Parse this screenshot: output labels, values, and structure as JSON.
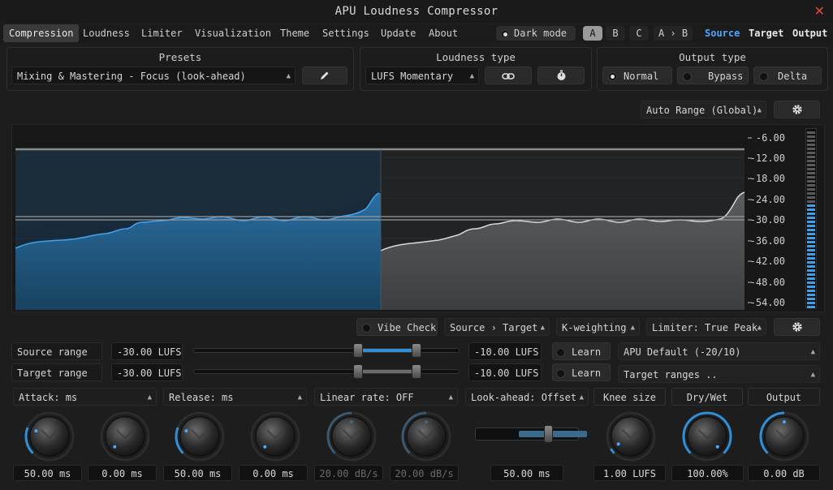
{
  "window": {
    "title": "APU Loudness Compressor",
    "close_glyph": "✕"
  },
  "menu": {
    "tabs": [
      "Compression",
      "Loudness",
      "Limiter",
      "Visualization",
      "Theme",
      "Settings",
      "Update",
      "About"
    ],
    "active_tab": "Compression",
    "dark_mode_label": "Dark mode",
    "ab": [
      "A",
      "B",
      "C",
      "A › B"
    ],
    "ab_active": "A",
    "views": [
      "Source",
      "Target",
      "Output"
    ],
    "view_active": "Source"
  },
  "presets": {
    "title": "Presets",
    "selected": "Mixing & Mastering - Focus (look-ahead)",
    "edit_icon": "pencil-icon"
  },
  "loudness_type": {
    "title": "Loudness type",
    "selected": "LUFS Momentary",
    "link_icon": "link-icon",
    "timer_icon": "stopwatch-icon"
  },
  "output_type": {
    "title": "Output type",
    "options": [
      "Normal",
      "Bypass",
      "Delta"
    ],
    "selected": "Normal"
  },
  "range_mode": {
    "selected": "Auto Range (Global)",
    "settings_icon": "gear-icon"
  },
  "graph": {
    "scale": [
      "-6.00",
      "-12.00",
      "-18.00",
      "-24.00",
      "-30.00",
      "-36.00",
      "-42.00",
      "-48.00",
      "-54.00"
    ],
    "meter_level": 0.58,
    "colors": {
      "source": "#2f8fd8",
      "target": "#d8d8d8",
      "source_fill": "#1f5277",
      "target_fill": "#4a4c4e"
    }
  },
  "controls_row": {
    "vibe_check": "Vibe Check",
    "signal": "Source › Target",
    "weighting": "K-weighting",
    "limiter": "Limiter: True Peak",
    "settings_icon": "gear-icon"
  },
  "ranges": {
    "source": {
      "label": "Source range",
      "min": "-30.00 LUFS",
      "max": "-10.00 LUFS",
      "learn": "Learn",
      "low": 0.62,
      "high": 0.84
    },
    "target": {
      "label": "Target range",
      "min": "-30.00 LUFS",
      "max": "-10.00 LUFS",
      "learn": "Learn",
      "low": 0.62,
      "high": 0.84
    },
    "preset": "APU Default (-20/10)",
    "target_ranges": "Target ranges .."
  },
  "params": {
    "attack": "Attack: ms",
    "release": "Release: ms",
    "linear_rate": "Linear rate: OFF",
    "lookahead": "Look-ahead: Offset",
    "knee": "Knee size",
    "drywet": "Dry/Wet",
    "output": "Output"
  },
  "knobs": [
    {
      "value": "50.00 ms",
      "dim": false,
      "level": 0.25
    },
    {
      "value": "0.00 ms",
      "dim": false,
      "level": 0.0
    },
    {
      "value": "50.00 ms",
      "dim": false,
      "level": 0.25
    },
    {
      "value": "0.00 ms",
      "dim": false,
      "level": 0.0
    },
    {
      "value": "20.00 dB/s",
      "dim": true,
      "level": 0.5
    },
    {
      "value": "20.00 dB/s",
      "dim": true,
      "level": 0.5
    },
    {
      "value": "1.00 LUFS",
      "dim": false,
      "level": 0.05
    },
    {
      "value": "100.00%",
      "dim": false,
      "level": 1.0
    },
    {
      "value": "0.00 dB",
      "dim": false,
      "level": 0.5
    }
  ],
  "lookahead_slider": {
    "value": "50.00 ms",
    "level": 0.72
  }
}
